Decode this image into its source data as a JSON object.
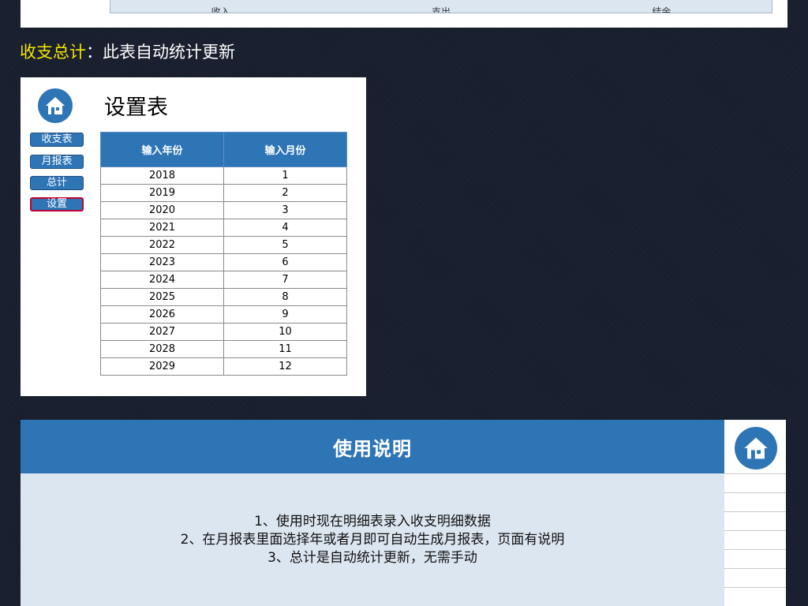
{
  "top_bar": {
    "labels": [
      "收入",
      "支出",
      "结余"
    ]
  },
  "section": {
    "highlight": "收支总计",
    "separator": "：",
    "description": "此表自动统计更新"
  },
  "settings": {
    "title": "设置表",
    "nav": [
      "收支表",
      "月报表",
      "总计",
      "设置"
    ],
    "active_nav": "设置",
    "columns": [
      "输入年份",
      "输入月份"
    ],
    "rows": [
      [
        "2018",
        "1"
      ],
      [
        "2019",
        "2"
      ],
      [
        "2020",
        "3"
      ],
      [
        "2021",
        "4"
      ],
      [
        "2022",
        "5"
      ],
      [
        "2023",
        "6"
      ],
      [
        "2024",
        "7"
      ],
      [
        "2025",
        "8"
      ],
      [
        "2026",
        "9"
      ],
      [
        "2027",
        "10"
      ],
      [
        "2028",
        "11"
      ],
      [
        "2029",
        "12"
      ]
    ]
  },
  "usage": {
    "title": "使用说明",
    "lines": [
      "1、使用时现在明细表录入收支明细数据",
      "2、在月报表里面选择年或者月即可自动生成月报表，页面有说明",
      "3、总计是自动统计更新，无需手动"
    ]
  },
  "icons": {
    "home": "home-icon"
  },
  "colors": {
    "accent": "#2e75b6",
    "highlight": "#f2e600",
    "light": "#dce6f1",
    "active_border": "#c00030"
  }
}
